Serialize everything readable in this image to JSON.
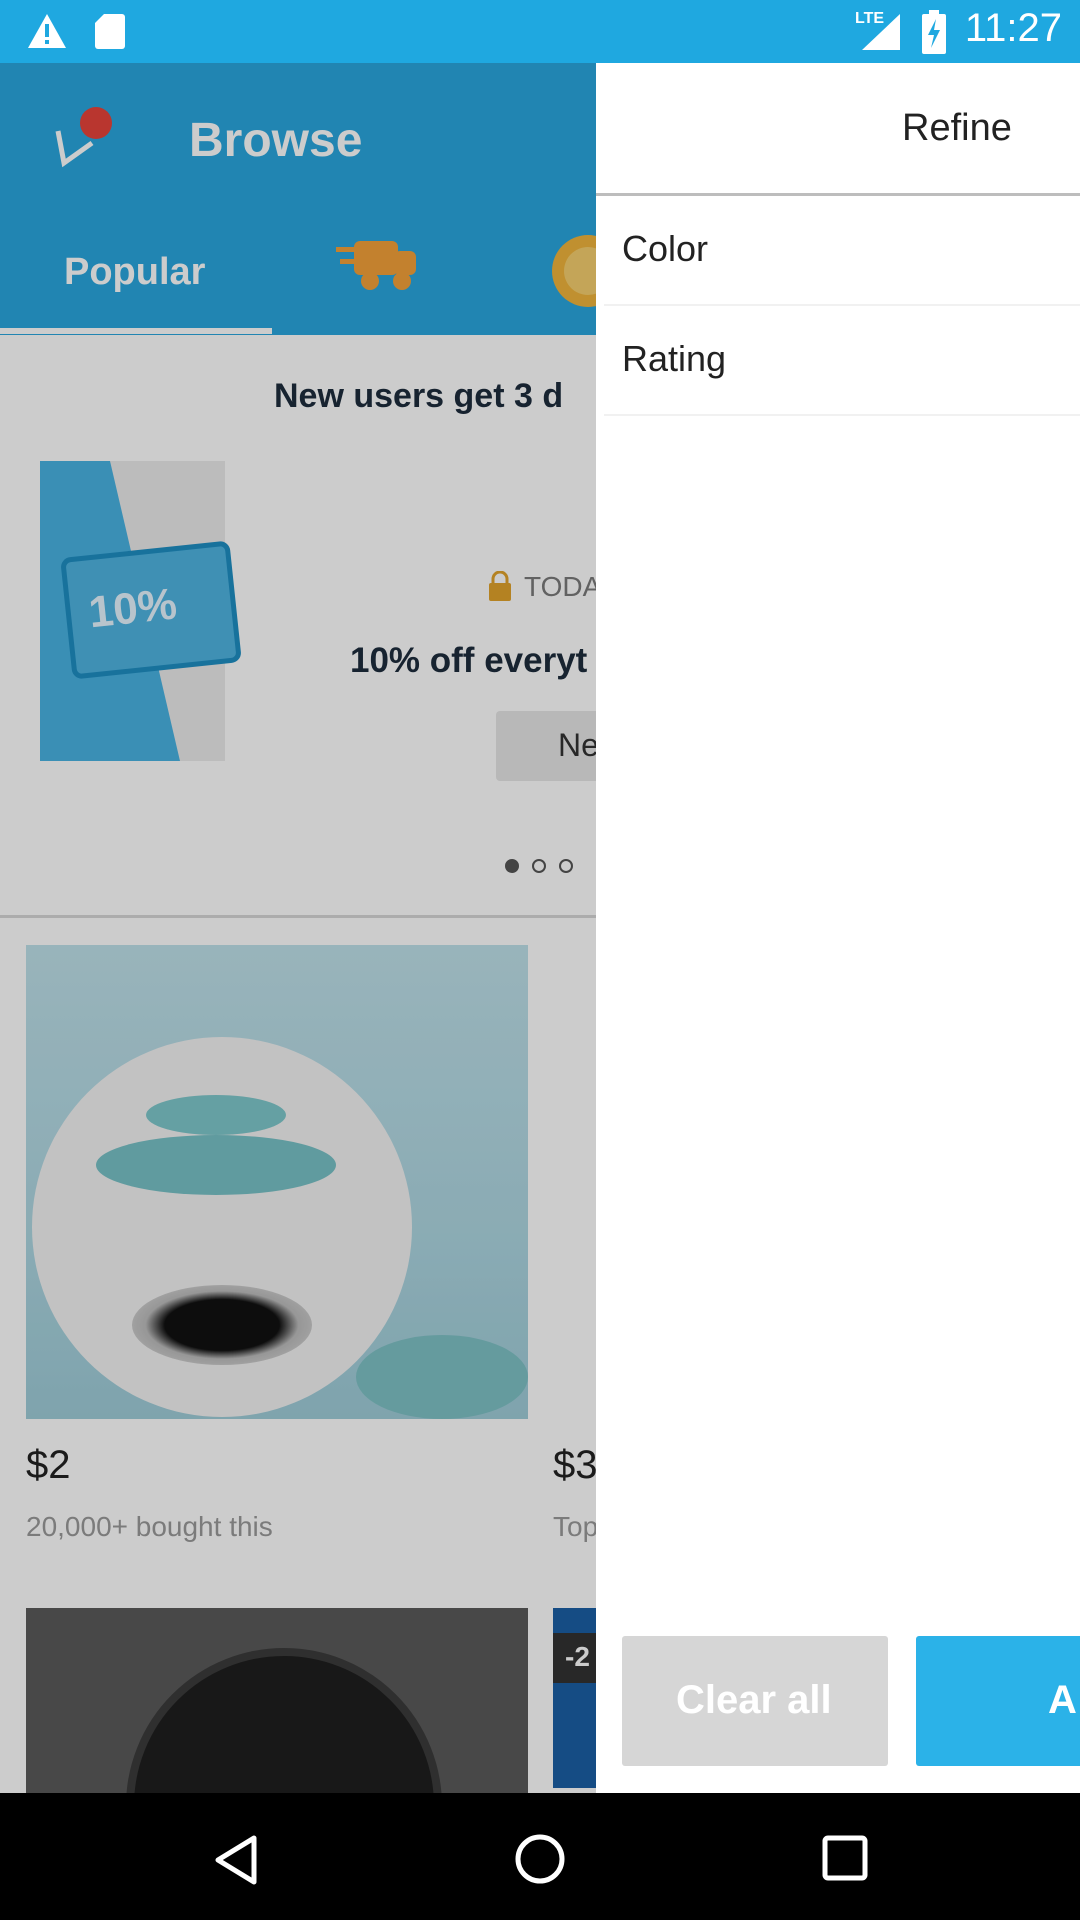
{
  "status_bar": {
    "time": "11:27",
    "network": "LTE",
    "icons": [
      "warning-icon",
      "sd-card-icon",
      "signal-icon",
      "battery-charging-icon"
    ]
  },
  "app": {
    "title": "Browse",
    "tabs": [
      {
        "label": "Popular",
        "selected": true
      },
      {
        "icon": "delivery-truck-icon"
      },
      {
        "icon": "coin-icon"
      }
    ],
    "promo": {
      "headline": "New users get 3 d",
      "today_label": "TODA",
      "offer": "10% off everyt",
      "coupon_text": "10%",
      "button_label": "Ne",
      "carousel_pages": 3,
      "carousel_active": 1
    },
    "products": [
      {
        "price": "$2",
        "subtitle": "20,000+ bought this"
      },
      {
        "price": "$3",
        "subtitle": "Top"
      },
      {
        "badge": ""
      },
      {
        "badge": "-2"
      }
    ]
  },
  "drawer": {
    "title": "Refine",
    "items": [
      {
        "label": "Color"
      },
      {
        "label": "Rating"
      }
    ],
    "clear_label": "Clear all",
    "apply_label": "A"
  },
  "colors": {
    "status_bar": "#1fa8e0",
    "app_bar": "#2aa7df",
    "apply_button": "#2bb2e8",
    "clear_button": "#d6d6d6"
  }
}
